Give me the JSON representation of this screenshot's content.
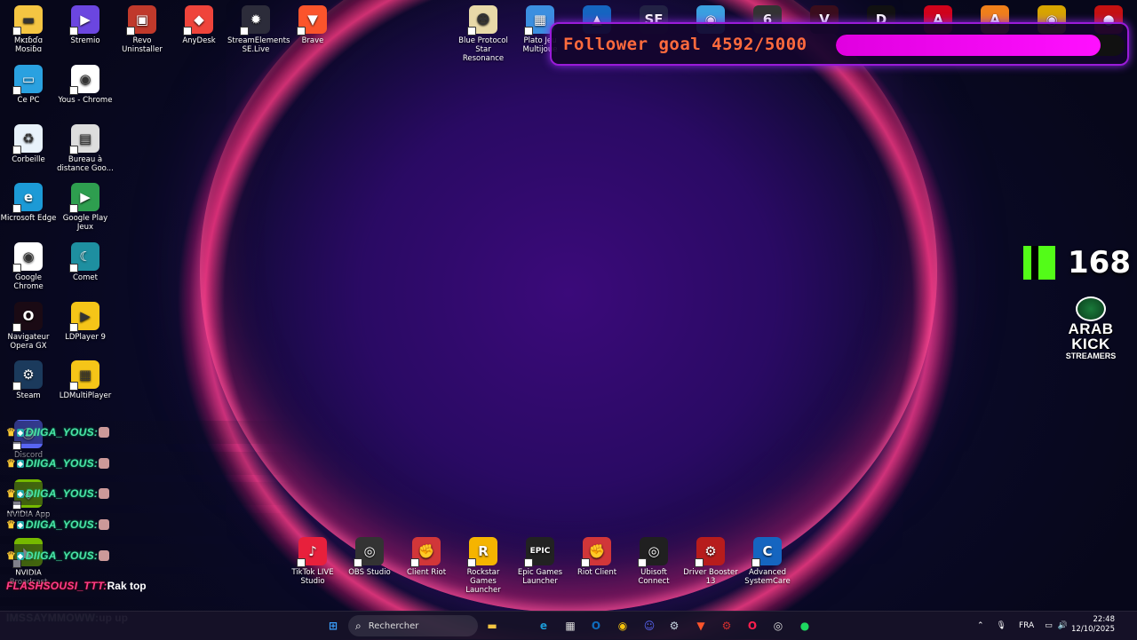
{
  "desktop_icons": [
    {
      "label": "Mᴋɪɓɗɑ\nMosiɓɑ",
      "name": "folder-icon",
      "color": "#f5c542",
      "glyph": "▬"
    },
    {
      "label": "Stremio",
      "name": "stremio-icon",
      "color": "#6b46e0",
      "glyph": "▶"
    },
    {
      "label": "Revo Uninstaller",
      "name": "revo-uninstaller-icon",
      "color": "#c0392b",
      "glyph": "▣"
    },
    {
      "label": "AnyDesk",
      "name": "anydesk-icon",
      "color": "#ef443b",
      "glyph": "◆"
    },
    {
      "label": "StreamElements\nSE.Live",
      "name": "streamelements-icon",
      "color": "#2c2c3a",
      "glyph": "✹"
    },
    {
      "label": "Brave",
      "name": "brave-icon",
      "color": "#fb542b",
      "glyph": "▼"
    },
    {
      "label": "Ce PC",
      "name": "this-pc-icon",
      "color": "#2aa1e0",
      "glyph": "▭"
    },
    {
      "label": "Yous - Chrome",
      "name": "chrome-profile-icon",
      "color": "#ffffff",
      "glyph": "◉"
    },
    {
      "label": "Corbeille",
      "name": "recycle-bin-icon",
      "color": "#e8f2fb",
      "glyph": "♻"
    },
    {
      "label": "Bureau à\ndistance Goo...",
      "name": "remote-desktop-icon",
      "color": "#dddddd",
      "glyph": "▤"
    },
    {
      "label": "Microsoft Edge",
      "name": "edge-icon",
      "color": "#1c9ad6",
      "glyph": "e"
    },
    {
      "label": "Google Play Jeux",
      "name": "google-play-games-icon",
      "color": "#2e9e4f",
      "glyph": "▶"
    },
    {
      "label": "Google Chrome",
      "name": "chrome-icon",
      "color": "#ffffff",
      "glyph": "◉"
    },
    {
      "label": "Comet",
      "name": "comet-icon",
      "color": "#1e8fa0",
      "glyph": "☾"
    },
    {
      "label": "Navigateur\nOpera GX",
      "name": "opera-gx-icon",
      "color": "#1a0a14",
      "glyph": "O"
    },
    {
      "label": "LDPlayer 9",
      "name": "ldplayer-icon",
      "color": "#f5c518",
      "glyph": "▶"
    },
    {
      "label": "Steam",
      "name": "steam-icon",
      "color": "#1b3a5c",
      "glyph": "⚙"
    },
    {
      "label": "LDMultiPlayer",
      "name": "ldmultiplayer-icon",
      "color": "#f5c518",
      "glyph": "▦"
    },
    {
      "label": "Discord",
      "name": "discord-icon",
      "color": "#5865f2",
      "glyph": "☺"
    },
    {
      "label": "NVIDIA App",
      "name": "nvidia-app-icon",
      "color": "#76b900",
      "glyph": "◈"
    },
    {
      "label": "NVIDIA\nBroadcast",
      "name": "nvidia-broadcast-icon",
      "color": "#76b900",
      "glyph": "◣"
    },
    {
      "label": "Blue Protocol\nStar Resonance",
      "name": "blue-protocol-icon",
      "color": "#e8d9a8",
      "glyph": "☻"
    },
    {
      "label": "Plato Jeu\nMultijoue",
      "name": "plato-icon",
      "color": "#3b8fe0",
      "glyph": "▦"
    },
    {
      "label": "",
      "name": "rocket-league-icon",
      "color": "#1565c0",
      "glyph": "▲"
    },
    {
      "label": "",
      "name": "se-icon",
      "color": "#222244",
      "glyph": "SE"
    },
    {
      "label": "",
      "name": "overwolf-icon",
      "color": "#3aa0e0",
      "glyph": "◉"
    },
    {
      "label": "",
      "name": "rainbow-six-icon",
      "color": "#333333",
      "glyph": "6"
    },
    {
      "label": "",
      "name": "valorant-icon",
      "color": "#3a0d1c",
      "glyph": "V"
    },
    {
      "label": "",
      "name": "d-app-icon",
      "color": "#111111",
      "glyph": "D"
    },
    {
      "label": "",
      "name": "apex-icon",
      "color": "#d0021b",
      "glyph": "A"
    },
    {
      "label": "",
      "name": "fall-app-icon",
      "color": "#f07f1a",
      "glyph": "A"
    },
    {
      "label": "",
      "name": "among-us-bot-icon",
      "color": "#d7a400",
      "glyph": "◉"
    },
    {
      "label": "",
      "name": "among-us-icon",
      "color": "#c51111",
      "glyph": "●"
    }
  ],
  "bottom_icons": [
    {
      "label": "TikTok LIVE\nStudio",
      "name": "tiktok-live-studio-icon",
      "color": "#e8203c",
      "glyph": "♪"
    },
    {
      "label": "OBS Studio",
      "name": "obs-studio-icon",
      "color": "#333333",
      "glyph": "◎"
    },
    {
      "label": "Client Riot",
      "name": "riot-client-icon",
      "color": "#d13639",
      "glyph": "✊"
    },
    {
      "label": "Rockstar Games\nLauncher",
      "name": "rockstar-launcher-icon",
      "color": "#f5b400",
      "glyph": "R"
    },
    {
      "label": "Epic Games\nLauncher",
      "name": "epic-games-icon",
      "color": "#222222",
      "glyph": "EPIC"
    },
    {
      "label": "Riot Client",
      "name": "riot-client-2-icon",
      "color": "#d13639",
      "glyph": "✊"
    },
    {
      "label": "Ubisoft Connect",
      "name": "ubisoft-connect-icon",
      "color": "#202020",
      "glyph": "◎"
    },
    {
      "label": "Driver Booster 13",
      "name": "driver-booster-icon",
      "color": "#b71c1c",
      "glyph": "⚙"
    },
    {
      "label": "Advanced\nSystemCare",
      "name": "advanced-systemcare-icon",
      "color": "#1565c0",
      "glyph": "C"
    }
  ],
  "follower_goal": {
    "label": "Follower goal 4592/5000",
    "current": 4592,
    "target": 5000
  },
  "kick": {
    "count": "168"
  },
  "arab_kick": {
    "line1": "ARAB KICK",
    "line2": "STREAMERS"
  },
  "chat": [
    {
      "user": "DIIGA_YOUS:",
      "style": "green"
    },
    {
      "user": "DIIGA_YOUS:",
      "style": "green"
    },
    {
      "user": "DIIGA_YOUS:",
      "style": "green"
    },
    {
      "user": "DIIGA_YOUS:",
      "style": "green"
    },
    {
      "user": "DIIGA_YOUS:",
      "style": "green"
    },
    {
      "user": "FLASHSOUSI_TTT:",
      "style": "pink",
      "message": "Rak top"
    },
    {
      "user": "IMSSAYMMOWW:",
      "style": "white",
      "message": "up up"
    }
  ],
  "taskbar": {
    "search_placeholder": "Rechercher",
    "language": "FRA",
    "time": "22:48",
    "date": "12/10/2025",
    "apps": [
      {
        "name": "start-icon",
        "glyph": "⊞",
        "color": "#3aa0ff"
      },
      {
        "name": "file-explorer-icon",
        "glyph": "▬",
        "color": "#f5c542"
      },
      {
        "name": "edge-icon",
        "glyph": "e",
        "color": "#1c9ad6"
      },
      {
        "name": "store-icon",
        "glyph": "▦",
        "color": "#dddddd"
      },
      {
        "name": "outlook-icon",
        "glyph": "O",
        "color": "#0f6cbd"
      },
      {
        "name": "chrome-icon",
        "glyph": "◉",
        "color": "#f4c20d"
      },
      {
        "name": "discord-icon",
        "glyph": "☺",
        "color": "#5865f2"
      },
      {
        "name": "steam-icon",
        "glyph": "⚙",
        "color": "#c7d5e0"
      },
      {
        "name": "brave-icon",
        "glyph": "▼",
        "color": "#fb542b"
      },
      {
        "name": "gear-red-icon",
        "glyph": "⚙",
        "color": "#d32f2f"
      },
      {
        "name": "opera-gx-icon",
        "glyph": "O",
        "color": "#ff1e4d"
      },
      {
        "name": "obs-icon",
        "glyph": "◎",
        "color": "#dddddd"
      },
      {
        "name": "spotify-icon",
        "glyph": "●",
        "color": "#1ed760"
      }
    ]
  }
}
